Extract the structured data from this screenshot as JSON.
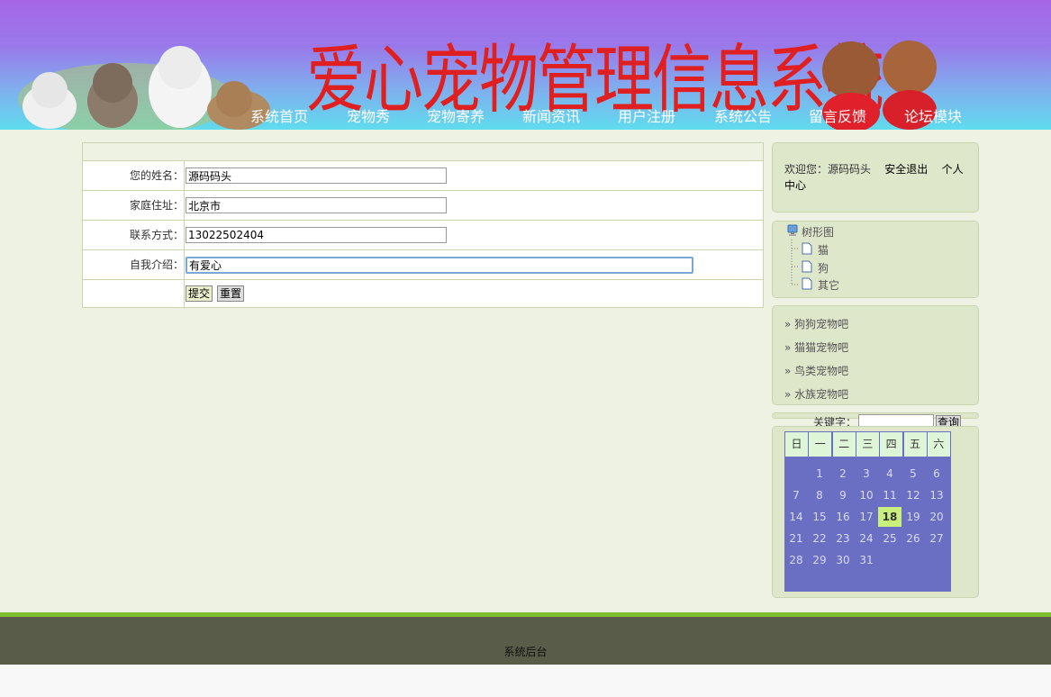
{
  "header": {
    "title": "爱心宠物管理信息系统",
    "nav": [
      "系统首页",
      "宠物秀",
      "宠物寄养",
      "新闻资讯",
      "用户注册",
      "系统公告",
      "留言反馈",
      "论坛模块"
    ]
  },
  "form": {
    "rows": [
      {
        "label": "您的姓名：",
        "value": "源码码头"
      },
      {
        "label": "家庭住址：",
        "value": "北京市"
      },
      {
        "label": "联系方式：",
        "value": "13022502404"
      },
      {
        "label": "自我介绍：",
        "value": "有爱心"
      }
    ],
    "submit_label": "提交",
    "reset_label": "重置"
  },
  "sidebar": {
    "welcome_prefix": "欢迎您：源码码头",
    "logout": "安全退出",
    "profile": "个人中心",
    "tree_root": "树形图",
    "tree_items": [
      "猫",
      "狗",
      "其它"
    ],
    "forums": [
      "» 狗狗宠物吧",
      "» 猫猫宠物吧",
      "» 鸟类宠物吧",
      "» 水族宠物吧"
    ],
    "search_label": "关键字：",
    "search_button": "查询"
  },
  "calendar": {
    "weekdays": [
      "日",
      "一",
      "二",
      "三",
      "四",
      "五",
      "六"
    ],
    "first_weekday": 1,
    "days": 31,
    "today": 18
  },
  "footer": {
    "text": "系统后台"
  },
  "colors": {
    "header_top": "#a566e6",
    "header_bottom": "#5fdcee",
    "title": "#e02020",
    "main_bg": "#eef2e3",
    "footer": "#585c48",
    "footer_line": "#7cbf2f",
    "calendar": "#6b6fc3",
    "today": "#c8f07a"
  }
}
